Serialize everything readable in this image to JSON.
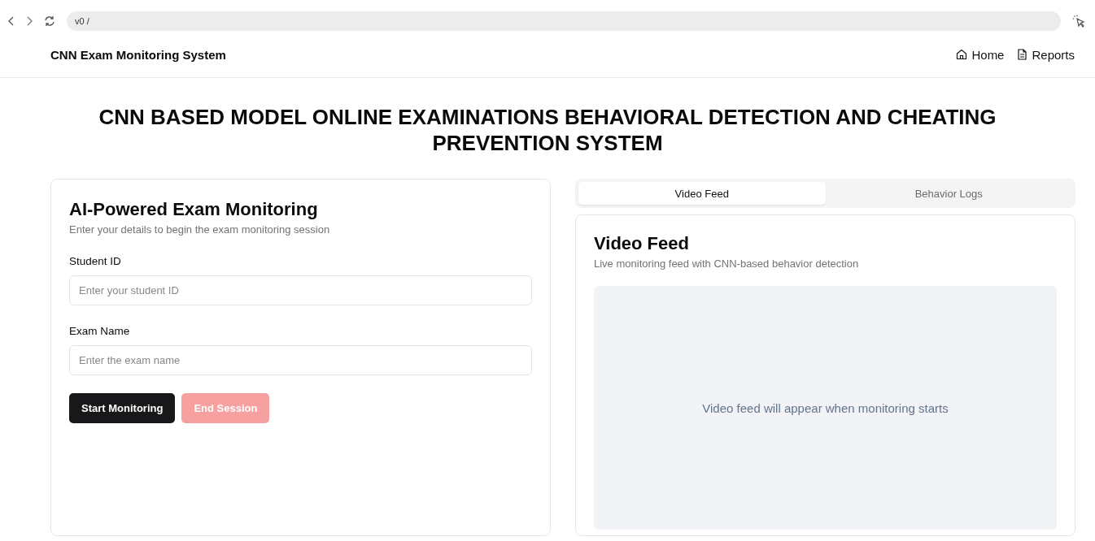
{
  "browser": {
    "address": "v0 /"
  },
  "header": {
    "brand": "CNN Exam Monitoring System",
    "nav": [
      "Home",
      "Reports"
    ]
  },
  "page_title": "CNN BASED MODEL ONLINE EXAMINATIONS BEHAVIORAL DETECTION AND CHEATING PREVENTION SYSTEM",
  "form_card": {
    "title": "AI-Powered Exam Monitoring",
    "description": "Enter your details to begin the exam monitoring session",
    "fields": [
      {
        "label": "Student ID",
        "placeholder": "Enter your student ID"
      },
      {
        "label": "Exam Name",
        "placeholder": "Enter the exam name"
      }
    ],
    "buttons": [
      {
        "label": "Start Monitoring",
        "kind": "primary",
        "disabled": false
      },
      {
        "label": "End Session",
        "kind": "danger",
        "disabled": true
      }
    ]
  },
  "tabs": [
    {
      "label": "Video Feed",
      "selected": true
    },
    {
      "label": "Behavior Logs",
      "selected": false
    }
  ],
  "video_card": {
    "title": "Video Feed",
    "description": "Live monitoring feed with CNN-based behavior detection",
    "empty_message": "Video feed will appear when monitoring starts"
  }
}
